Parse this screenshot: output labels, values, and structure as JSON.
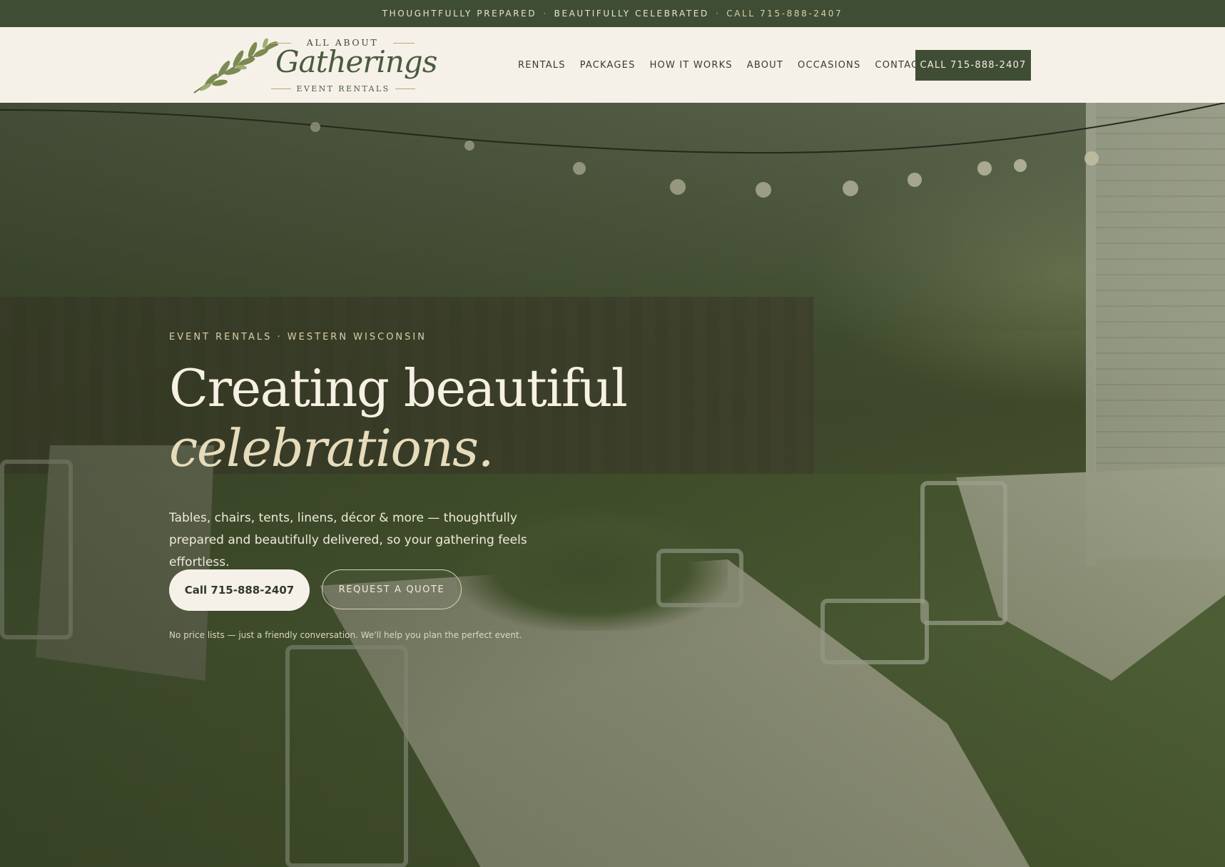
{
  "topbar": {
    "part1": "THOUGHTFULLY PREPARED",
    "sep1": "·",
    "part2": "BEAUTIFULLY CELEBRATED",
    "sep2": "·",
    "phone": "CALL 715-888-2407"
  },
  "logo": {
    "top": "ALL ABOUT",
    "main": "Gatherings",
    "sub": "EVENT RENTALS"
  },
  "nav": {
    "items": [
      "RENTALS",
      "PACKAGES",
      "HOW IT WORKS",
      "ABOUT",
      "OCCASIONS",
      "CONTACT"
    ],
    "cta": "CALL 715-888-2407"
  },
  "hero": {
    "eyebrow": "EVENT RENTALS · WESTERN WISCONSIN",
    "headline_line1": "Creating beautiful",
    "headline_line2": "celebrations.",
    "lede": "Tables, chairs, tents, linens, décor & more — thoughtfully prepared and beautifully delivered, so your gathering feels effortless.",
    "primary_button": "Call 715-888-2407",
    "secondary_button": "REQUEST A QUOTE",
    "note": "No price lists — just a friendly conversation. We'll help you plan the perfect event."
  },
  "colors": {
    "brand_green": "#3f4d35",
    "cream": "#f5f1e8",
    "accent_gold": "#d9cfa8"
  }
}
